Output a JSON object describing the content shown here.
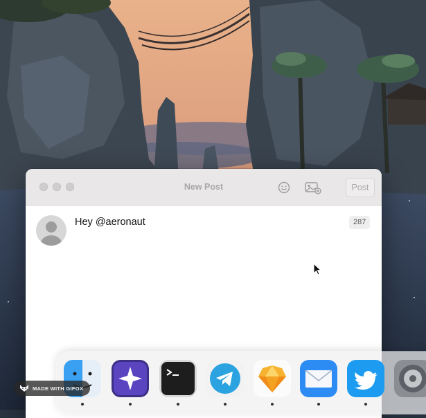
{
  "window": {
    "title": "New Post",
    "post_label": "Post",
    "compose_text": "Hey @aeronaut",
    "char_count": "287"
  },
  "dock": {
    "apps": [
      {
        "name": "finder",
        "running": true
      },
      {
        "name": "spark",
        "running": true
      },
      {
        "name": "terminal",
        "running": true
      },
      {
        "name": "telegram",
        "running": true
      },
      {
        "name": "sketch",
        "running": true
      },
      {
        "name": "mail",
        "running": true
      },
      {
        "name": "twitter",
        "running": true
      },
      {
        "name": "system-preferences",
        "running": false
      }
    ]
  },
  "watermark": {
    "text": "MADE WITH GIFOX"
  },
  "colors": {
    "titlebar": "#e9e7e7",
    "dim_text": "#a8a6a6",
    "telegram_blue": "#2aa3e0",
    "twitter_blue": "#1d9bf0"
  }
}
